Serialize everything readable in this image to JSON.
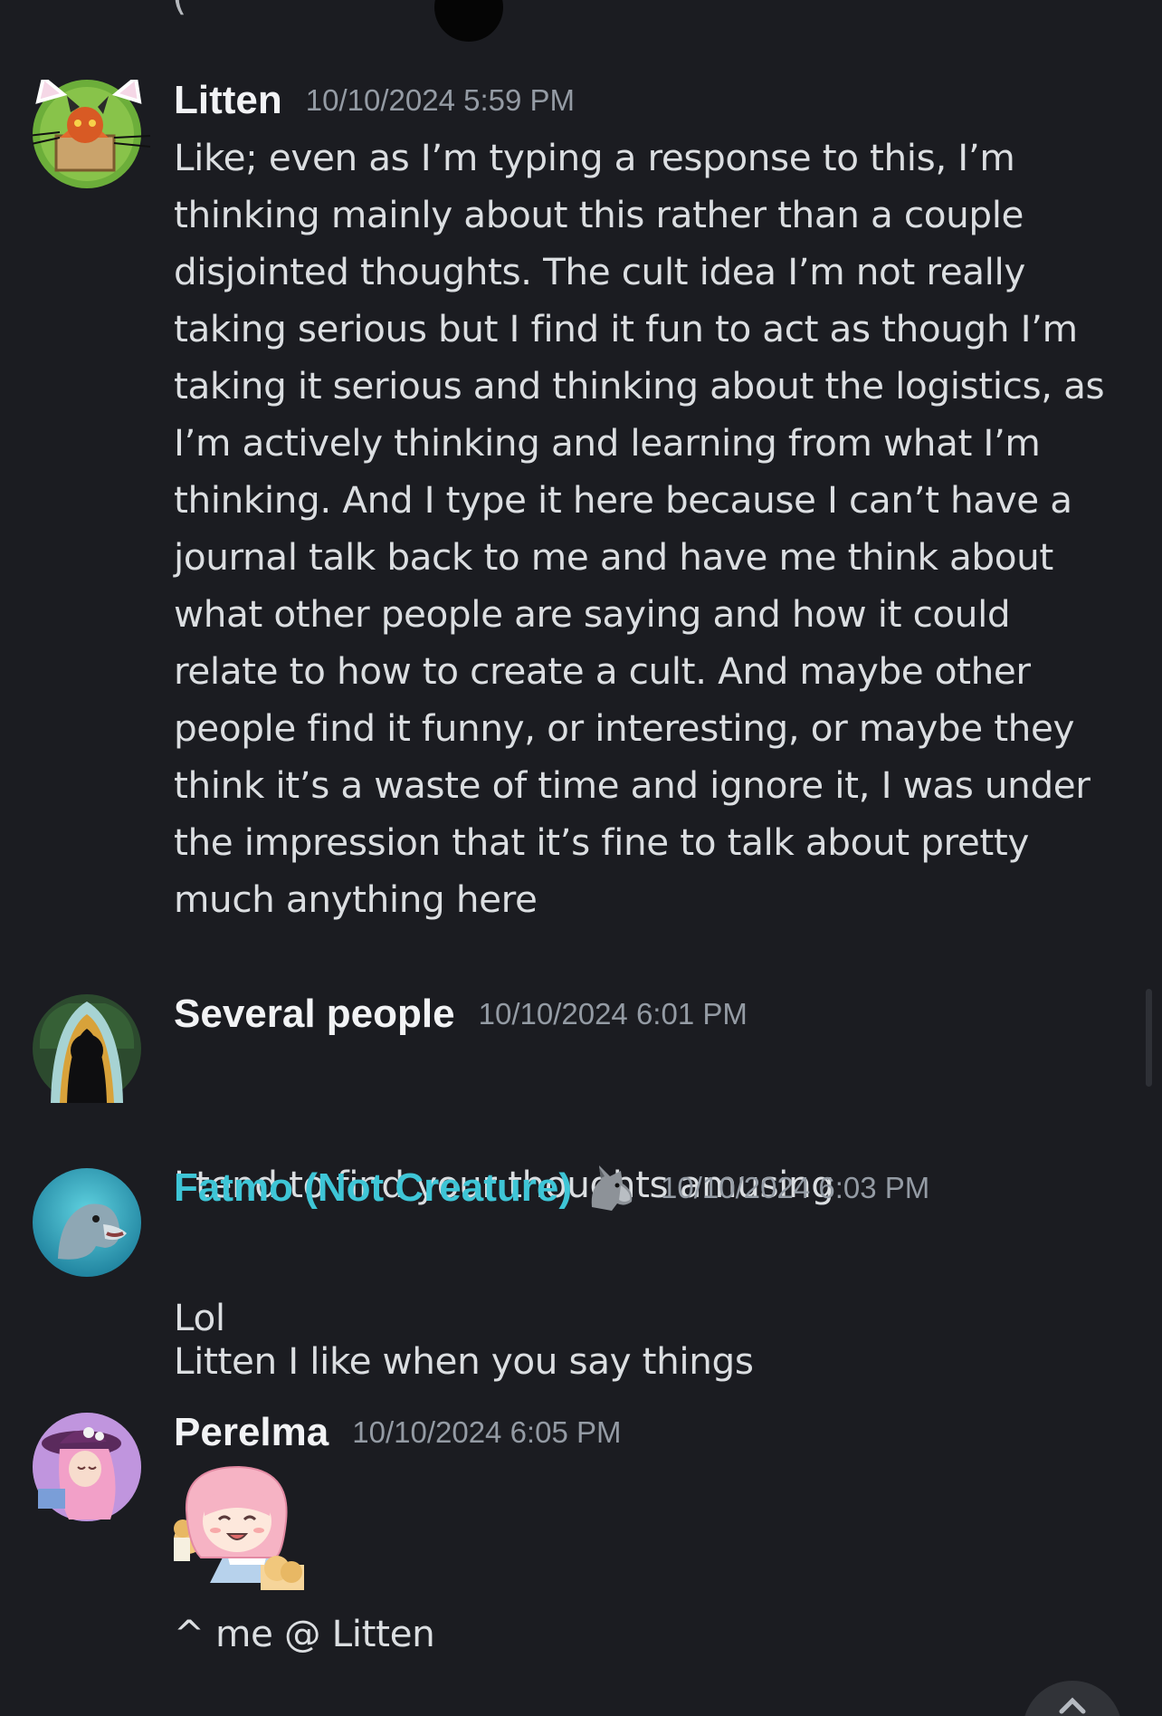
{
  "messages": [
    {
      "username": "Litten",
      "timestamp": "10/10/2024 5:59 PM",
      "avatar_icon": "cat-in-box-avatar",
      "lines": [
        "Like; even as I’m typing a response to this, I’m",
        "thinking mainly about this rather than a couple",
        "disjointed thoughts. The cult idea I’m not really",
        "taking serious but I find it fun to act as though I’m",
        "taking it serious and thinking about the logistics, as",
        "I’m actively thinking and learning from what I’m",
        "thinking. And I type it here because I can’t have a",
        "journal talk back to me and have me think about",
        "what other people are saying and how it could",
        "relate to how to create a cult. And maybe other",
        "people find it funny, or interesting, or maybe they",
        "think it’s a waste of time and ignore it, I was under",
        "the impression that it’s fine to talk about pretty",
        "much anything here"
      ]
    },
    {
      "username": "Several people",
      "timestamp": "10/10/2024 6:01 PM",
      "avatar_icon": "hooded-figure-avatar",
      "lines": [
        "I tend to find your thoughts amusing"
      ]
    },
    {
      "username": "Fatmo (Not Creature)",
      "username_color": "#3ec5d6",
      "role_icon": "wolf-icon",
      "timestamp": "10/10/2024 6:03 PM",
      "avatar_icon": "dolphin-avatar",
      "lines": [
        "Litten I like when you say things"
      ],
      "followup": "Lol"
    },
    {
      "username": "Perelma",
      "timestamp": "10/10/2024 6:05 PM",
      "avatar_icon": "pink-hair-girl-avatar",
      "sticker": "cheering-anime-girl-sticker",
      "followup": "^ me @ Litten"
    }
  ],
  "theme": {
    "background": "#1b1c21",
    "text": "#dbdee1",
    "username": "#f2f3f5",
    "timestamp": "#949ba4",
    "accent_teal": "#3ec5d6"
  }
}
